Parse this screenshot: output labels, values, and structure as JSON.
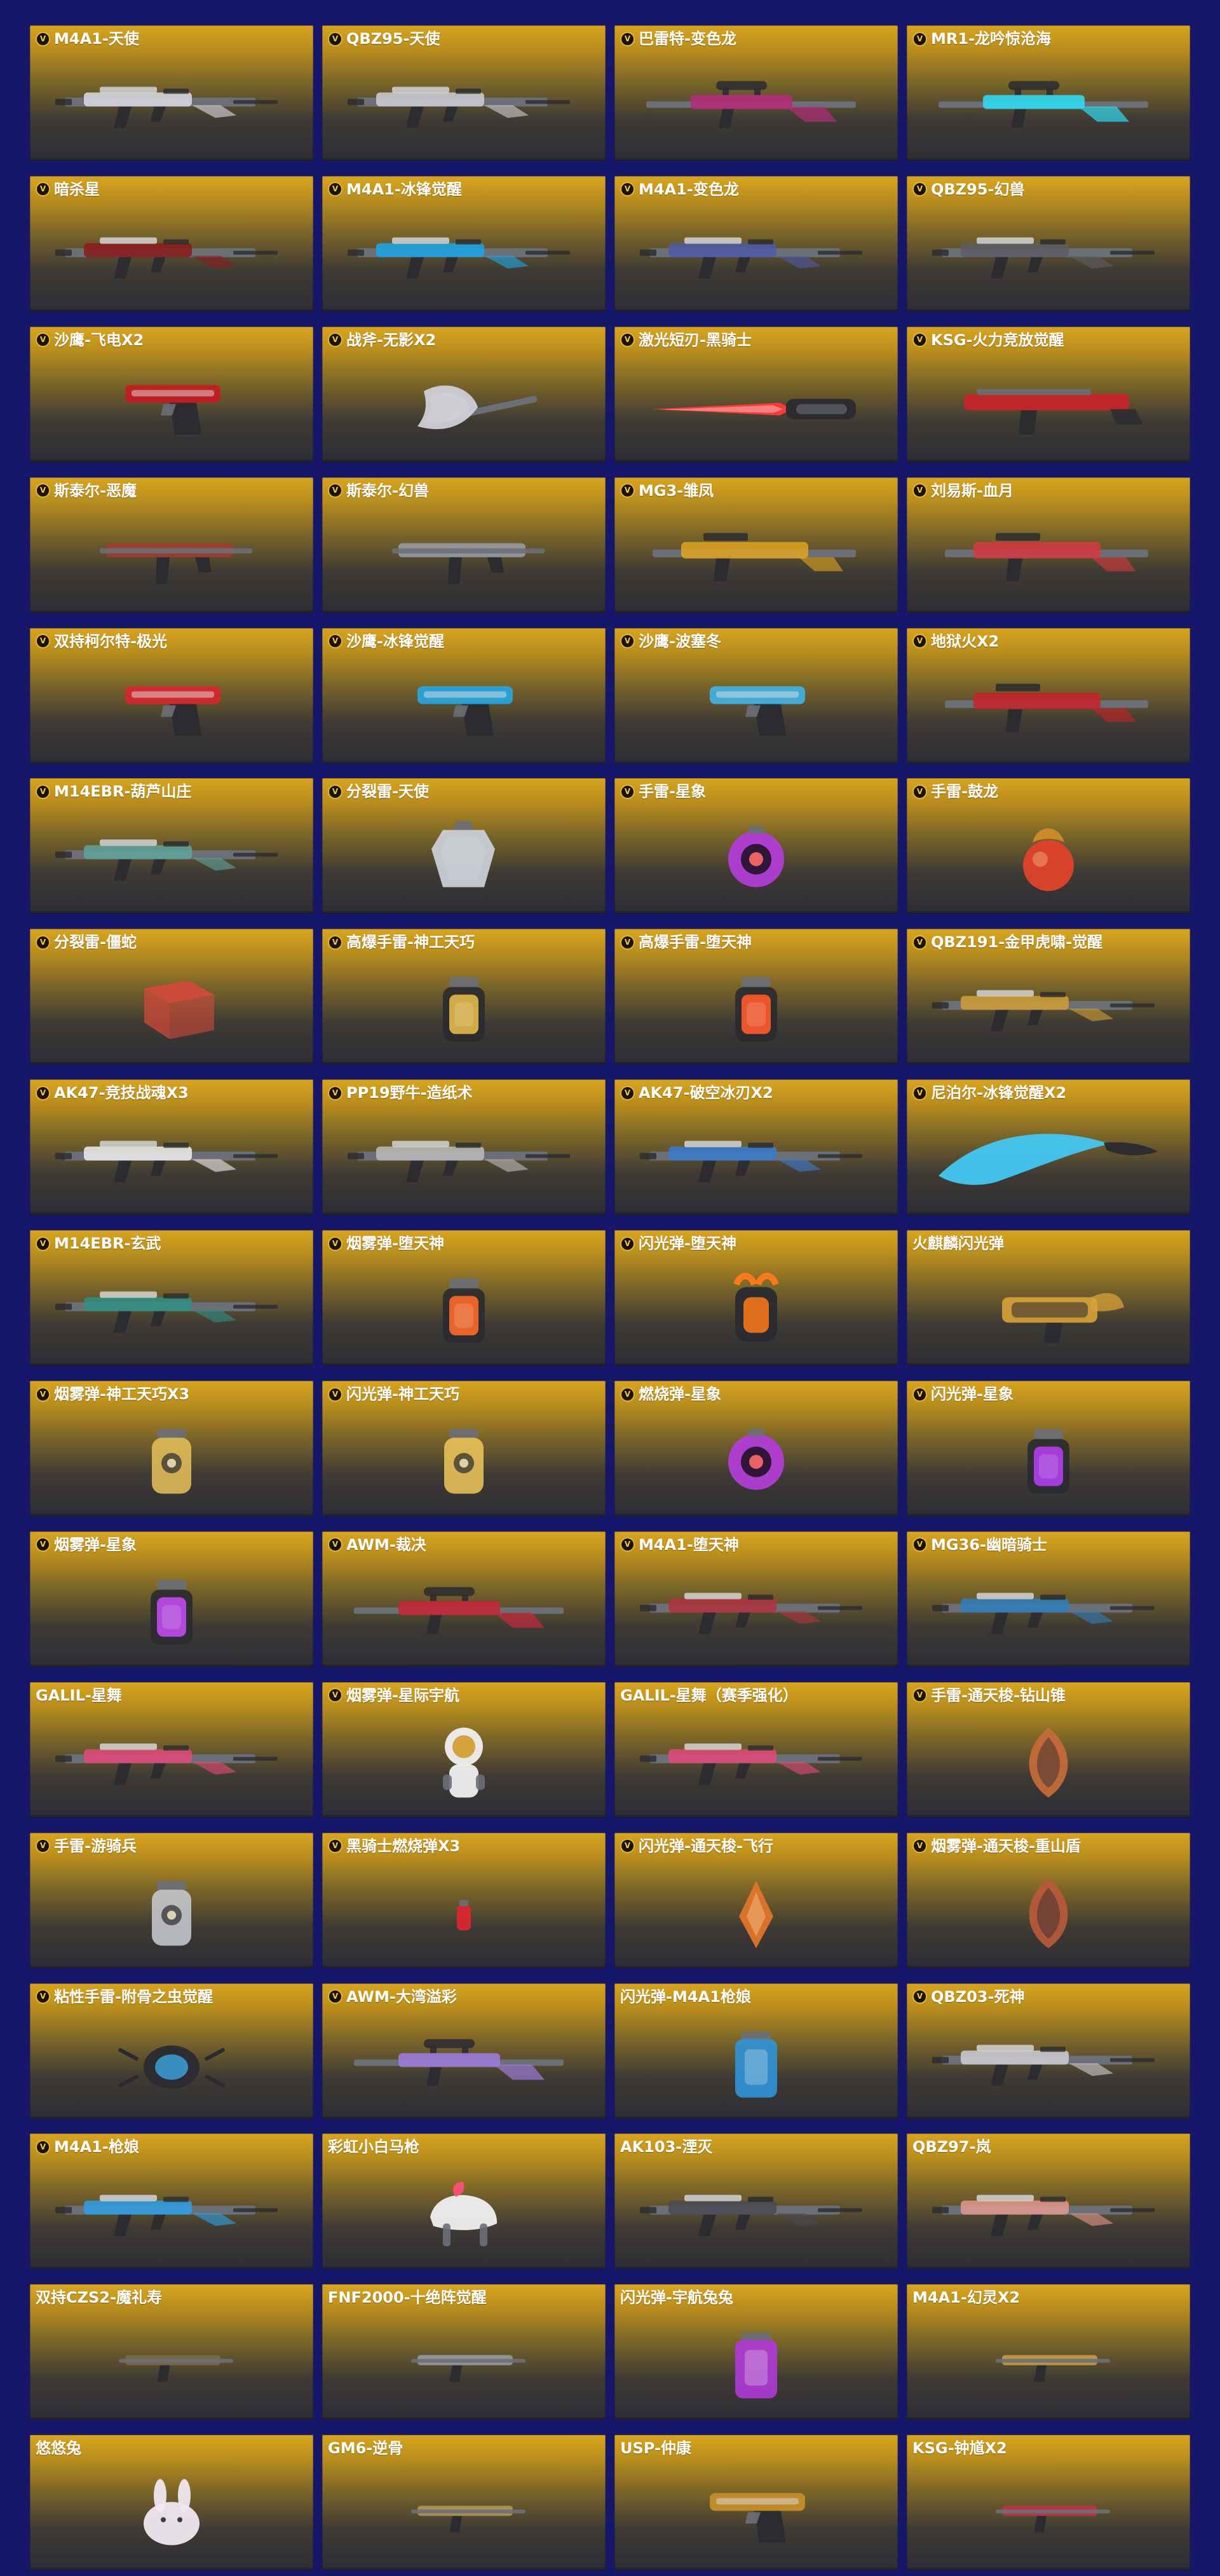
{
  "items": [
    {
      "name": "M4A1-天使",
      "vip": true,
      "kind": "rifle",
      "accent": "#dcdce6"
    },
    {
      "name": "QBZ95-天使",
      "vip": true,
      "kind": "rifle",
      "accent": "#cfcfd7"
    },
    {
      "name": "巴雷特-变色龙",
      "vip": true,
      "kind": "sniper",
      "accent": "#b42c7a"
    },
    {
      "name": "MR1-龙吟惊沧海",
      "vip": true,
      "kind": "sniper",
      "accent": "#31d9f2"
    },
    {
      "name": "暗杀星",
      "vip": true,
      "kind": "rifle",
      "accent": "#8b1a1a"
    },
    {
      "name": "M4A1-冰锋觉醒",
      "vip": true,
      "kind": "rifle",
      "accent": "#1ba7e9"
    },
    {
      "name": "M4A1-变色龙",
      "vip": true,
      "kind": "rifle",
      "accent": "#4f5aa8"
    },
    {
      "name": "QBZ95-幻兽",
      "vip": true,
      "kind": "rifle",
      "accent": "#5d5d66"
    },
    {
      "name": "沙鹰-飞电X2",
      "vip": true,
      "kind": "pistol",
      "accent": "#c81b22"
    },
    {
      "name": "战斧-无影X2",
      "vip": true,
      "kind": "axe",
      "accent": "#cfcfd7"
    },
    {
      "name": "激光短刃-黑骑士",
      "vip": true,
      "kind": "blade",
      "accent": "#ff3b3b"
    },
    {
      "name": "KSG-火力竞放觉醒",
      "vip": true,
      "kind": "shotgun",
      "accent": "#d0212a"
    },
    {
      "name": "斯泰尔-恶魔",
      "vip": true,
      "kind": "smg",
      "accent": "#a23b2e"
    },
    {
      "name": "斯泰尔-幻兽",
      "vip": true,
      "kind": "smg",
      "accent": "#9aa0a8"
    },
    {
      "name": "MG3-雏凤",
      "vip": true,
      "kind": "lmg",
      "accent": "#e1a522"
    },
    {
      "name": "刘易斯-血月",
      "vip": true,
      "kind": "lmg",
      "accent": "#d73841"
    },
    {
      "name": "双持柯尔特-极光",
      "vip": true,
      "kind": "pistol",
      "accent": "#d9262f"
    },
    {
      "name": "沙鹰-冰锋觉醒",
      "vip": true,
      "kind": "pistol",
      "accent": "#23a9e6"
    },
    {
      "name": "沙鹰-波塞冬",
      "vip": true,
      "kind": "pistol",
      "accent": "#3fb4e8"
    },
    {
      "name": "地狱火X2",
      "vip": true,
      "kind": "lmg",
      "accent": "#c72228"
    },
    {
      "name": "M14EBR-葫芦山庄",
      "vip": true,
      "kind": "rifle",
      "accent": "#5fa59c"
    },
    {
      "name": "分裂雷-天使",
      "vip": true,
      "kind": "grenade",
      "accent": "#c9cdd5"
    },
    {
      "name": "手雷-星象",
      "vip": true,
      "kind": "grenade-eye",
      "accent": "#b13dd6"
    },
    {
      "name": "手雷-鼓龙",
      "vip": true,
      "kind": "grenade-orb",
      "accent": "#e0422a"
    },
    {
      "name": "分裂雷-僵蛇",
      "vip": true,
      "kind": "cube",
      "accent": "#d24a3a"
    },
    {
      "name": "高爆手雷-神工天巧",
      "vip": true,
      "kind": "canister",
      "accent": "#e4b84a"
    },
    {
      "name": "高爆手雷-堕天神",
      "vip": true,
      "kind": "canister",
      "accent": "#ff5a2a"
    },
    {
      "name": "QBZ191-金甲虎啸-觉醒",
      "vip": true,
      "kind": "rifle",
      "accent": "#d0a036"
    },
    {
      "name": "AK47-竞技战魂X3",
      "vip": true,
      "kind": "rifle",
      "accent": "#f0f0f0"
    },
    {
      "name": "PP19野牛-造纸术",
      "vip": true,
      "kind": "rifle",
      "accent": "#bcbcbc"
    },
    {
      "name": "AK47-破空冰刃X2",
      "vip": true,
      "kind": "rifle",
      "accent": "#3a7bd0"
    },
    {
      "name": "尼泊尔-冰锋觉醒X2",
      "vip": true,
      "kind": "knife",
      "accent": "#43c6f2"
    },
    {
      "name": "M14EBR-玄武",
      "vip": true,
      "kind": "rifle",
      "accent": "#2f8f85"
    },
    {
      "name": "烟雾弹-堕天神",
      "vip": true,
      "kind": "canister",
      "accent": "#ff6a2a"
    },
    {
      "name": "闪光弹-堕天神",
      "vip": true,
      "kind": "grenade-horn",
      "accent": "#ff7a1a"
    },
    {
      "name": "火麒麟闪光弹",
      "vip": false,
      "kind": "launcher",
      "accent": "#d9a23a"
    },
    {
      "name": "烟雾弹-神工天巧X3",
      "vip": true,
      "kind": "lantern",
      "accent": "#e8c15a"
    },
    {
      "name": "闪光弹-神工天巧",
      "vip": true,
      "kind": "lantern",
      "accent": "#f0c85a"
    },
    {
      "name": "燃烧弹-星象",
      "vip": true,
      "kind": "grenade-eye",
      "accent": "#b13dd6"
    },
    {
      "name": "闪光弹-星象",
      "vip": true,
      "kind": "canister",
      "accent": "#b23ff0"
    },
    {
      "name": "烟雾弹-星象",
      "vip": true,
      "kind": "canister",
      "accent": "#c04af0"
    },
    {
      "name": "AWM-裁决",
      "vip": true,
      "kind": "sniper",
      "accent": "#c4293a"
    },
    {
      "name": "M4A1-堕天神",
      "vip": true,
      "kind": "rifle",
      "accent": "#b0333e"
    },
    {
      "name": "MG36-幽暗骑士",
      "vip": true,
      "kind": "rifle",
      "accent": "#2f7fc0"
    },
    {
      "name": "GALIL-星舞",
      "vip": false,
      "kind": "rifle",
      "accent": "#e34a7a"
    },
    {
      "name": "烟雾弹-星际宇航",
      "vip": true,
      "kind": "astronaut",
      "accent": "#f0f0f0"
    },
    {
      "name": "GALIL-星舞（赛季强化）",
      "vip": false,
      "kind": "rifle",
      "accent": "#e34a7a"
    },
    {
      "name": "手雷-通天梭-钻山锥",
      "vip": true,
      "kind": "shell",
      "accent": "#c46a3a"
    },
    {
      "name": "手雷-游骑兵",
      "vip": true,
      "kind": "lantern",
      "accent": "#c9cdd5"
    },
    {
      "name": "黑骑士燃烧弹X3",
      "vip": true,
      "kind": "small",
      "accent": "#d9262f"
    },
    {
      "name": "闪光弹-通天梭-飞行",
      "vip": true,
      "kind": "crystal",
      "accent": "#e0752a"
    },
    {
      "name": "烟雾弹-通天梭-重山盾",
      "vip": true,
      "kind": "shell",
      "accent": "#b55a3a"
    },
    {
      "name": "粘性手雷-附骨之虫觉醒",
      "vip": true,
      "kind": "bug",
      "accent": "#3aa0d8"
    },
    {
      "name": "AWM-大湾溢彩",
      "vip": true,
      "kind": "sniper",
      "accent": "#9c7ad8"
    },
    {
      "name": "闪光弹-M4A1枪娘",
      "vip": false,
      "kind": "can",
      "accent": "#2f94d8"
    },
    {
      "name": "QBZ03-死神",
      "vip": true,
      "kind": "rifle",
      "accent": "#cfcfd7"
    },
    {
      "name": "M4A1-枪娘",
      "vip": true,
      "kind": "rifle",
      "accent": "#2fa0e6"
    },
    {
      "name": "彩虹小白马枪",
      "vip": false,
      "kind": "horse",
      "accent": "#f0f0f0"
    },
    {
      "name": "AK103-湮灭",
      "vip": false,
      "kind": "rifle",
      "accent": "#4a4a55"
    },
    {
      "name": "QBZ97-岚",
      "vip": false,
      "kind": "rifle",
      "accent": "#e39a8e"
    },
    {
      "name": "双持CZS2-魔礼寿",
      "vip": false,
      "kind": "smg-small",
      "accent": "#7a6b4a"
    },
    {
      "name": "FNF2000-十绝阵觉醒",
      "vip": false,
      "kind": "smg-small",
      "accent": "#9aa0a8"
    },
    {
      "name": "闪光弹-宇航兔兔",
      "vip": false,
      "kind": "can",
      "accent": "#b03ad8"
    },
    {
      "name": "M4A1-幻灵X2",
      "vip": false,
      "kind": "smg-small",
      "accent": "#c9a04a"
    },
    {
      "name": "悠悠兔",
      "vip": false,
      "kind": "rabbit",
      "accent": "#f0e8f0"
    },
    {
      "name": "GM6-逆骨",
      "vip": false,
      "kind": "smg-small",
      "accent": "#b59a5a"
    },
    {
      "name": "USP-仲康",
      "vip": false,
      "kind": "pistol",
      "accent": "#c9902a"
    },
    {
      "name": "KSG-钟馗X2",
      "vip": false,
      "kind": "smg-small",
      "accent": "#c2334a"
    }
  ]
}
